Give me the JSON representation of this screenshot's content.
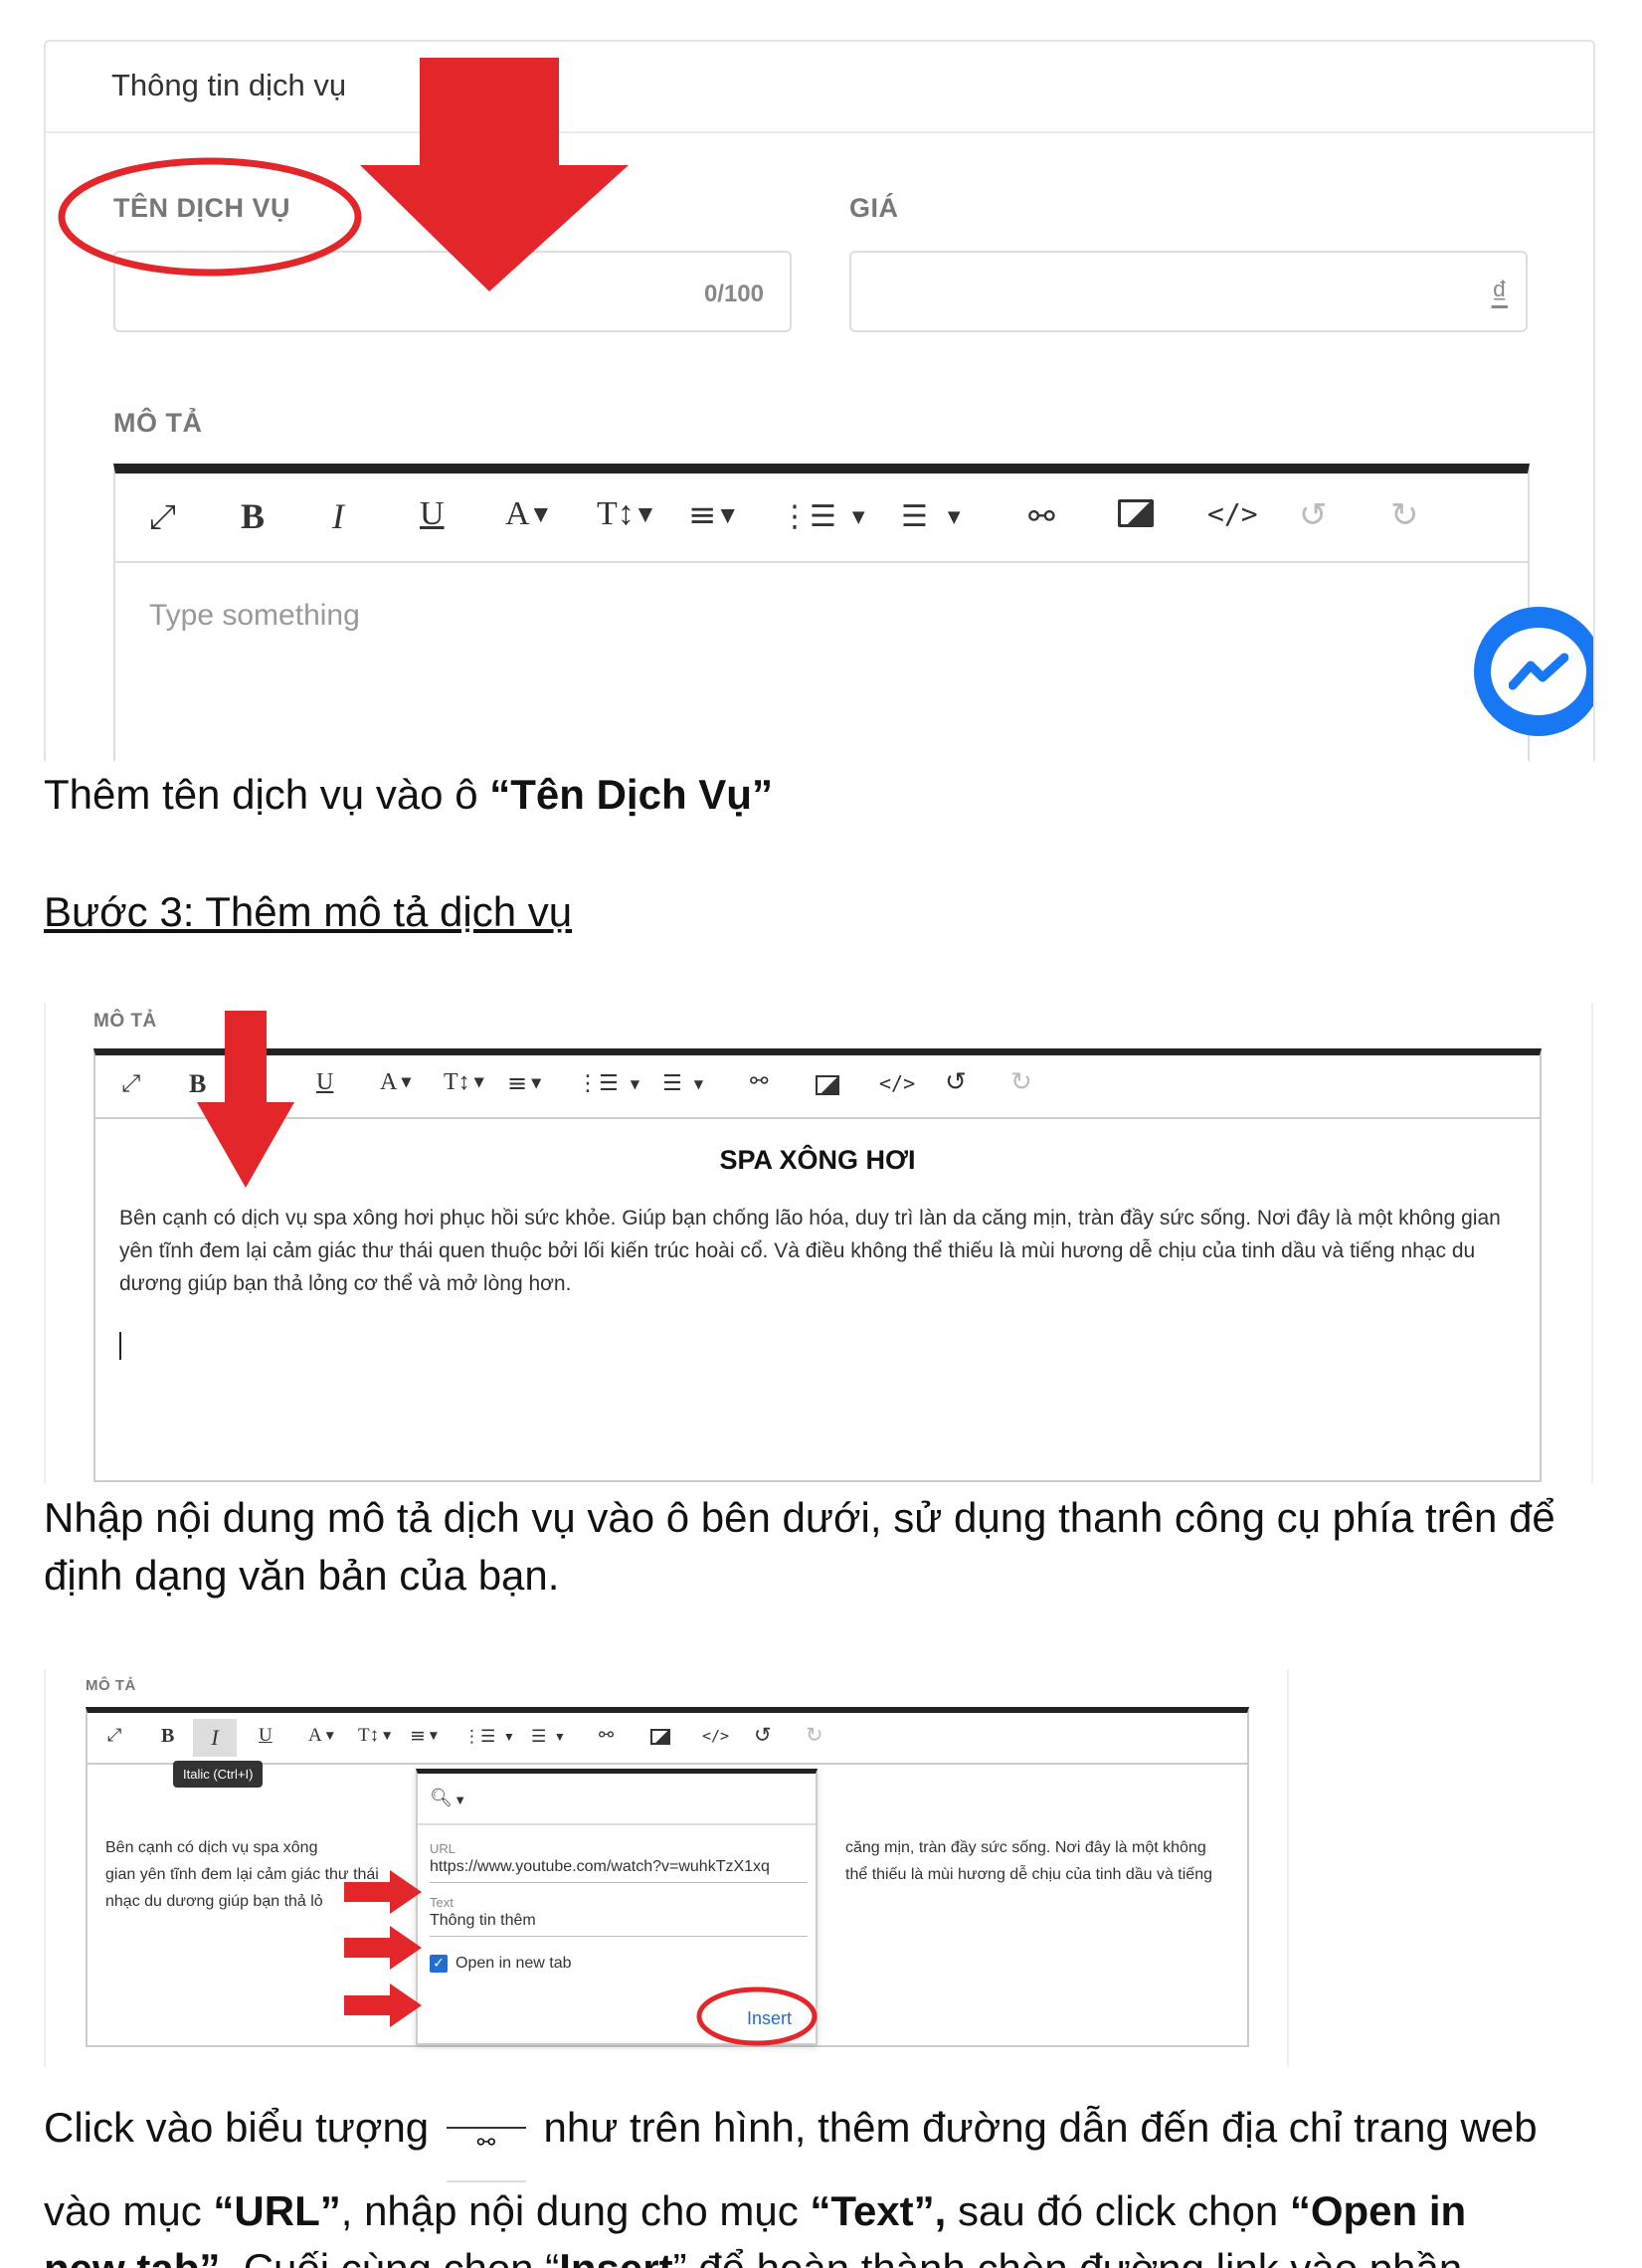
{
  "shot1": {
    "card_title": "Thông tin dịch vụ",
    "name_label": "TÊN DỊCH VỤ",
    "name_counter": "0/100",
    "price_label": "GIÁ",
    "price_unit": "₫",
    "desc_label": "MÔ TẢ",
    "toolbar": [
      "expand-icon",
      "B",
      "I",
      "U",
      "A",
      "T↕",
      "align",
      "ordered-list",
      "unordered-list",
      "link-icon",
      "image-icon",
      "code-icon",
      "undo-icon",
      "redo-icon"
    ],
    "editor_placeholder": "Type something"
  },
  "caption1": {
    "text": "Thêm tên dịch vụ vào ô ",
    "bold": "“Tên Dịch Vụ”"
  },
  "step3_heading": "Bước 3: Thêm mô tả dịch vụ",
  "shot2": {
    "desc_label": "MÔ TẢ",
    "editor_title": "SPA XÔNG HƠI",
    "editor_body": "Bên cạnh có dịch vụ spa xông hơi phục hồi sức khỏe. Giúp bạn chống lão hóa, duy trì làn da căng mịn, tràn đầy sức sống. Nơi đây là một không gian yên tĩnh đem lại cảm giác thư thái quen thuộc bởi lối kiến trúc hoài cổ. Và điều không thể thiếu là mùi hương dễ chịu của tinh dầu và tiếng nhạc du dương giúp bạn thả lỏng cơ thể và mở lòng hơn."
  },
  "caption2": "Nhập nội dung mô tả dịch vụ vào ô bên dưới, sử dụng thanh công cụ phía trên để định dạng văn bản của bạn.",
  "shot3": {
    "desc_label": "MÔ TẢ",
    "tooltip": "Italic (Ctrl+I)",
    "left_line1": "Bên cạnh có dịch vụ spa xông",
    "left_line2": "gian yên tĩnh đem lại cảm giác thư thái",
    "left_line3": "nhạc du dương giúp bạn thả lỏ",
    "right_line1": "căng mịn, tràn đầy sức sống. Nơi đây là một không",
    "right_line2": "thể thiếu là mùi hương dễ chịu của tinh dầu và tiếng",
    "url_label": "URL",
    "url_value": "https://www.youtube.com/watch?v=wuhkTzX1xq",
    "text_label": "Text",
    "text_value": "Thông tin thêm",
    "checkbox_label": "Open in new tab",
    "insert_label": "Insert"
  },
  "caption3": {
    "p1": "Click vào biểu tượng",
    "p2": "như trên hình, thêm đường dẫn đến địa chỉ trang web",
    "p3": "vào mục ",
    "url": "“URL”",
    "p4": ", nhập nội dung cho mục ",
    "text": "“Text”,",
    "p5": " sau đó click chọn ",
    "open": "“Open in",
    "open2": "new tab”.",
    "p6": " Cuối cùng chọn “",
    "insert": "Insert",
    "p7": "”  để hoàn thành chèn đường link vào phần"
  },
  "colors": {
    "accent_red": "#e3262a",
    "link_blue": "#1f6ed4",
    "messenger_blue": "#1877f2"
  }
}
